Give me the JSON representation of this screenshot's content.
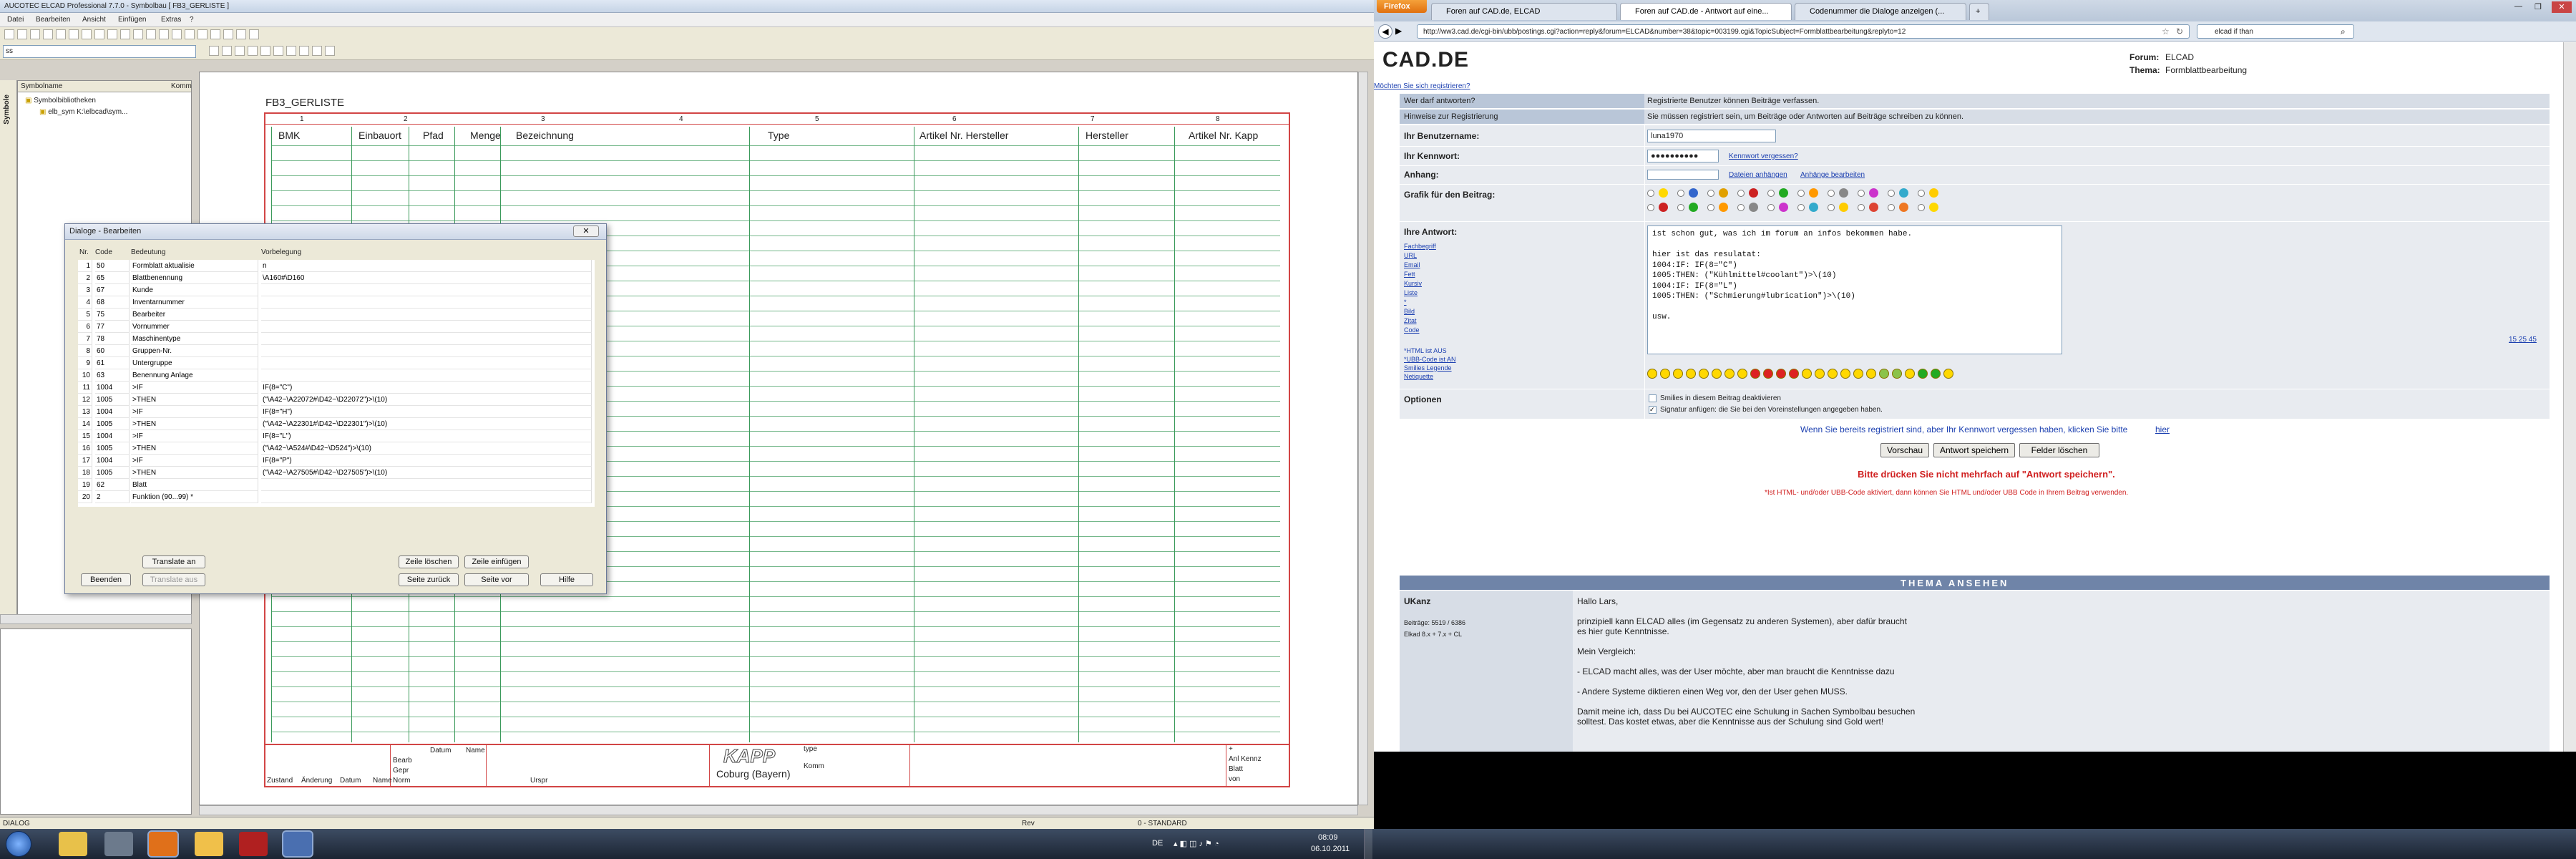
{
  "left_app": {
    "title": "AUCOTEC    ELCAD Professional 7.7.0 - Symbolbau [ FB3_GERLISTE ]",
    "menu": [
      "Datei",
      "Bearbeiten",
      "Ansicht",
      "Einfügen",
      "Extras",
      "?"
    ],
    "combo_value": "ss",
    "panel": {
      "header_name": "Symbolname",
      "header_comment": "Komm",
      "tab": "Symbole",
      "tree": [
        "Symbolbibliotheken",
        "elb_sym    K:\\elbcad\\sym..."
      ]
    },
    "drawing": {
      "title": "FB3_GERLISTE",
      "ruler": [
        "1",
        "2",
        "3",
        "4",
        "5",
        "6",
        "7",
        "8"
      ],
      "columns": [
        "BMK",
        "Einbauort",
        "Pfad",
        "Menge",
        "Bezeichnung",
        "Type",
        "Artikel Nr. Hersteller",
        "Hersteller",
        "Artikel Nr. Kapp"
      ],
      "footer": {
        "datum": "Datum",
        "name": "Name",
        "bearb": "Bearb",
        "gepr": "Gepr",
        "norm": "Norm",
        "zustand": "Zustand",
        "aenderung": "Änderung",
        "datum2": "Datum",
        "name2": "Name",
        "urspr": "Urspr",
        "logo": "KAPP",
        "city": "Coburg (Bayern)",
        "type": "type",
        "komm": "Komm",
        "anl": "Anl Kennz",
        "blatt": "Blatt",
        "von": "von",
        "plus": "+"
      }
    },
    "dialog": {
      "title": "Dialoge - Bearbeiten",
      "headers": [
        "Nr.",
        "Code",
        "Bedeutung",
        "Vorbelegung"
      ],
      "rows": [
        [
          "1",
          "50",
          "Formblatt aktualisie",
          "n"
        ],
        [
          "2",
          "65",
          "Blattbenennung",
          "\\A160#\\D160"
        ],
        [
          "3",
          "67",
          "Kunde",
          ""
        ],
        [
          "4",
          "68",
          "Inventarnummer",
          ""
        ],
        [
          "5",
          "75",
          "Bearbeiter",
          ""
        ],
        [
          "6",
          "77",
          "Vornummer",
          ""
        ],
        [
          "7",
          "78",
          "Maschinentype",
          ""
        ],
        [
          "8",
          "60",
          "Gruppen-Nr.",
          ""
        ],
        [
          "9",
          "61",
          "Untergruppe",
          ""
        ],
        [
          "10",
          "63",
          "Benennung Anlage",
          ""
        ],
        [
          "11",
          "1004",
          ">IF",
          "IF(8=\"C\")"
        ],
        [
          "12",
          "1005",
          ">THEN",
          "(\"\\A42~\\A22072#\\D42~\\D22072\")>\\(10)"
        ],
        [
          "13",
          "1004",
          ">IF",
          "IF(8=\"H\")"
        ],
        [
          "14",
          "1005",
          ">THEN",
          "(\"\\A42~\\A22301#\\D42~\\D22301\")>\\(10)"
        ],
        [
          "15",
          "1004",
          ">IF",
          "IF(8=\"L\")"
        ],
        [
          "16",
          "1005",
          ">THEN",
          "(\"\\A42~\\A524#\\D42~\\D524\")>\\(10)"
        ],
        [
          "17",
          "1004",
          ">IF",
          "IF(8=\"P\")"
        ],
        [
          "18",
          "1005",
          ">THEN",
          "(\"\\A42~\\A27505#\\D42~\\D27505\")>\\(10)"
        ],
        [
          "19",
          "62",
          "Blatt",
          ""
        ],
        [
          "20",
          "2",
          "Funktion (90...99)  *",
          ""
        ]
      ],
      "buttons": {
        "translate_an": "Translate an",
        "translate_aus": "Translate aus",
        "zeile_loeschen": "Zeile löschen",
        "zeile_einfuegen": "Zeile einfügen",
        "beenden": "Beenden",
        "seite_zurueck": "Seite zurück",
        "seite_vor": "Seite vor",
        "hilfe": "Hilfe"
      }
    },
    "status": {
      "left": "DIALOG",
      "rev": "Rev",
      "standard": "0 - STANDARD"
    }
  },
  "browser": {
    "firefox_label": "Firefox",
    "tabs": [
      "Foren auf CAD.de, ELCAD",
      "Foren auf CAD.de - Antwort auf eine...",
      "Codenummer die Dialoge anzeigen (...",
      "+"
    ],
    "url": "http://ww3.cad.de/cgi-bin/ubb/postings.cgi?action=reply&forum=ELCAD&number=38&topic=003199.cgi&TopicSubject=Formblattbearbeitung&replyto=12",
    "search": "elcad if than",
    "logo": "CAD.DE",
    "forum_label": "Forum:",
    "forum": "ELCAD",
    "thema_label": "Thema:",
    "thema": "Formblattbearbeitung",
    "register_link": "Möchten Sie sich registrieren?",
    "form": {
      "who_label": "Wer darf antworten?",
      "who_value": "Registrierte Benutzer können Beiträge verfassen.",
      "hint_label": "Hinweise zur Registrierung",
      "hint_value": "Sie müssen registriert sein, um Beiträge oder Antworten auf Beiträge schreiben zu können.",
      "user_label": "Ihr Benutzername:",
      "user_value": "luna1970",
      "pass_label": "Ihr Kennwort:",
      "pass_value": "●●●●●●●●●●",
      "pass_forgot": "Kennwort vergessen?",
      "attach_label": "Anhang:",
      "attach_link1": "Dateien anhängen",
      "attach_link2": "Anhänge bearbeiten",
      "grafik_label": "Grafik für den Beitrag:",
      "answer_label": "Ihre Antwort:",
      "side_links": [
        "Fachbegriff",
        "URL",
        "Email",
        "Fett",
        "Kursiv",
        "Liste",
        "*",
        "Bild",
        "Zitat",
        "Code"
      ],
      "side_info": [
        "*HTML ist AUS",
        "*UBB-Code ist AN",
        "Smilies Legende",
        "Netiquette"
      ],
      "textarea": "ist schon gut, was ich im forum an infos bekommen habe.\n\nhier ist das resulatat:\n1004:IF: IF(8=\"C\")\n1005:THEN: (\"Kühlmittel#coolant\")>\\(10)\n1004:IF: IF(8=\"L\")\n1005:THEN: (\"Schmierung#lubrication\")>\\(10)\n\nusw.",
      "sizes": "15 25 45",
      "options_label": "Optionen",
      "opt1": "Smilies in diesem Beitrag deaktivieren",
      "opt2": "Signatur anfügen: die Sie bei den Voreinstellungen angegeben haben.",
      "forgot_text": "Wenn Sie bereits registriert sind, aber Ihr Kennwort vergessen haben, klicken Sie bitte",
      "forgot_link": "hier",
      "btn_preview": "Vorschau",
      "btn_save": "Antwort speichern",
      "btn_clear": "Felder löschen",
      "warn": "Bitte drücken Sie nicht mehrfach auf \"Antwort speichern\".",
      "note": "*Ist HTML- und/oder UBB-Code aktiviert, dann können Sie HTML und/oder UBB Code in Ihrem Beitrag verwenden."
    },
    "thread": {
      "header": "THEMA ANSEHEN",
      "author": "UKanz",
      "posts": "Beiträge: 5519 / 6386",
      "extra": "Elkad 8.x + 7.x + CL",
      "lines": [
        "Hallo Lars,",
        "prinzipiell kann ELCAD alles (im Gegensatz zu anderen Systemen), aber dafür braucht",
        "es hier gute Kenntnisse.",
        "Mein Vergleich:",
        "- ELCAD macht alles, was der User möchte, aber man braucht die Kenntnisse dazu",
        "- Andere Systeme diktieren einen Weg vor, den der User gehen MUSS.",
        "Damit meine ich, dass Du bei AUCOTEC eine Schulung in Sachen Symbolbau besuchen",
        "solltest. Das kostet etwas, aber die Kenntnisse aus der Schulung sind Gold wert!"
      ]
    }
  },
  "taskbar": {
    "lang": "DE",
    "time": "08:09",
    "date": "06.10.2011"
  },
  "colors": {
    "grid": "#3a9a5a",
    "frame": "#d24545",
    "forum_row": "#d7dde6",
    "forum_header": "#6f84a8",
    "warn": "#d02020"
  }
}
